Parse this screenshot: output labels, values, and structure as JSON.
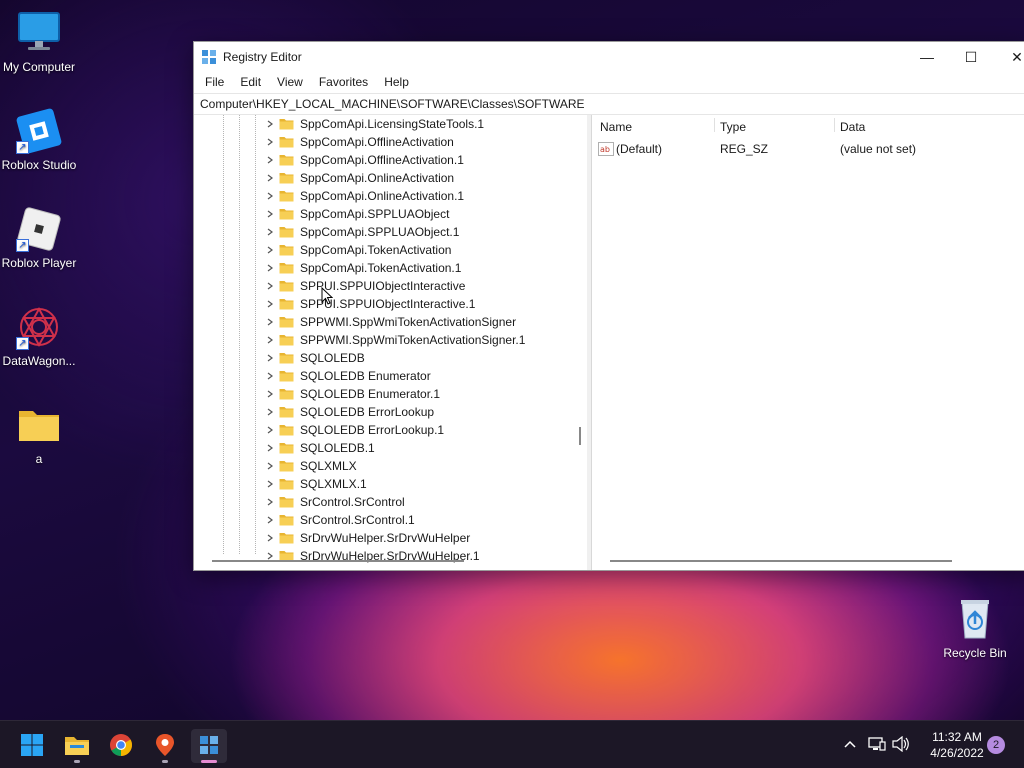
{
  "desktop": {
    "icons": [
      {
        "label": "My Computer",
        "icon": "monitor-icon"
      },
      {
        "label": "Roblox Studio",
        "icon": "roblox-studio-icon"
      },
      {
        "label": "Roblox Player",
        "icon": "roblox-player-icon"
      },
      {
        "label": "DataWagon...",
        "icon": "datawagon-icon"
      },
      {
        "label": "a",
        "icon": "folder-icon"
      },
      {
        "label": "Recycle Bin",
        "icon": "recycle-bin-icon"
      }
    ]
  },
  "window": {
    "title": "Registry Editor",
    "controls": {
      "minimize": "—",
      "maximize": "☐",
      "close": "✕"
    },
    "menu": [
      "File",
      "Edit",
      "View",
      "Favorites",
      "Help"
    ],
    "address": "Computer\\HKEY_LOCAL_MACHINE\\SOFTWARE\\Classes\\SOFTWARE",
    "tree_items": [
      "SppComApi.LicensingStateTools.1",
      "SppComApi.OfflineActivation",
      "SppComApi.OfflineActivation.1",
      "SppComApi.OnlineActivation",
      "SppComApi.OnlineActivation.1",
      "SppComApi.SPPLUAObject",
      "SppComApi.SPPLUAObject.1",
      "SppComApi.TokenActivation",
      "SppComApi.TokenActivation.1",
      "SPPUI.SPPUIObjectInteractive",
      "SPPUI.SPPUIObjectInteractive.1",
      "SPPWMI.SppWmiTokenActivationSigner",
      "SPPWMI.SppWmiTokenActivationSigner.1",
      "SQLOLEDB",
      "SQLOLEDB Enumerator",
      "SQLOLEDB Enumerator.1",
      "SQLOLEDB ErrorLookup",
      "SQLOLEDB ErrorLookup.1",
      "SQLOLEDB.1",
      "SQLXMLX",
      "SQLXMLX.1",
      "SrControl.SrControl",
      "SrControl.SrControl.1",
      "SrDrvWuHelper.SrDrvWuHelper",
      "SrDrvWuHelper.SrDrvWuHelper.1"
    ],
    "columns": {
      "name": "Name",
      "type": "Type",
      "data": "Data"
    },
    "values": [
      {
        "name": "(Default)",
        "type": "REG_SZ",
        "data": "(value not set)"
      }
    ]
  },
  "taskbar": {
    "apps": [
      "start-icon",
      "file-explorer-icon",
      "chrome-icon",
      "maps-icon",
      "regedit-icon"
    ],
    "time": "11:32 AM",
    "date": "4/26/2022",
    "notifications": "2",
    "colors": {
      "accent": "#e58bd2",
      "folder": "#f5c842",
      "windows_blue": "#1e90e8"
    }
  }
}
